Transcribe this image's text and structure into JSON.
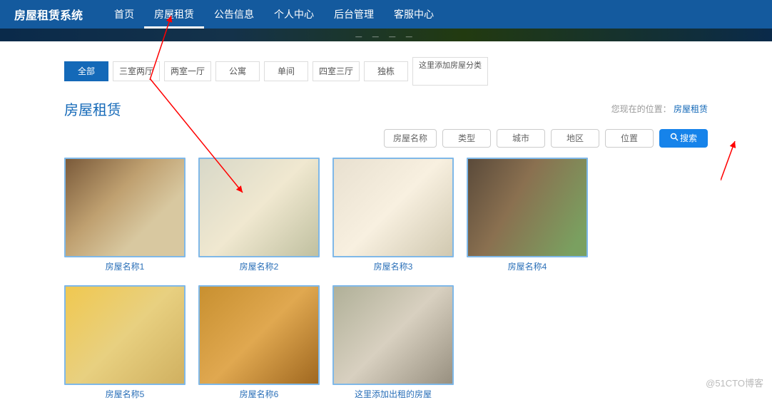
{
  "logo": "房屋租赁系统",
  "nav": {
    "items": [
      "首页",
      "房屋租赁",
      "公告信息",
      "个人中心",
      "后台管理",
      "客服中心"
    ],
    "activeIndex": 1
  },
  "categories": {
    "items": [
      "全部",
      "三室两厅",
      "两室一厅",
      "公寓",
      "单间",
      "四室三厅",
      "独栋"
    ],
    "activeIndex": 0,
    "extra": "这里添加房屋分类"
  },
  "page_title": "房屋租赁",
  "breadcrumb": {
    "prefix": "您现在的位置：",
    "current": "房屋租赁"
  },
  "filters": [
    "房屋名称",
    "类型",
    "城市",
    "地区",
    "位置"
  ],
  "search_label": "搜索",
  "cards": [
    {
      "title": "房屋名称1",
      "cls": "r1"
    },
    {
      "title": "房屋名称2",
      "cls": "r2"
    },
    {
      "title": "房屋名称3",
      "cls": "r3"
    },
    {
      "title": "房屋名称4",
      "cls": "r4"
    },
    {
      "title": "房屋名称5",
      "cls": "r5"
    },
    {
      "title": "房屋名称6",
      "cls": "r6"
    },
    {
      "title": "这里添加出租的房屋",
      "cls": "r7"
    }
  ],
  "watermark": "@51CTO博客"
}
